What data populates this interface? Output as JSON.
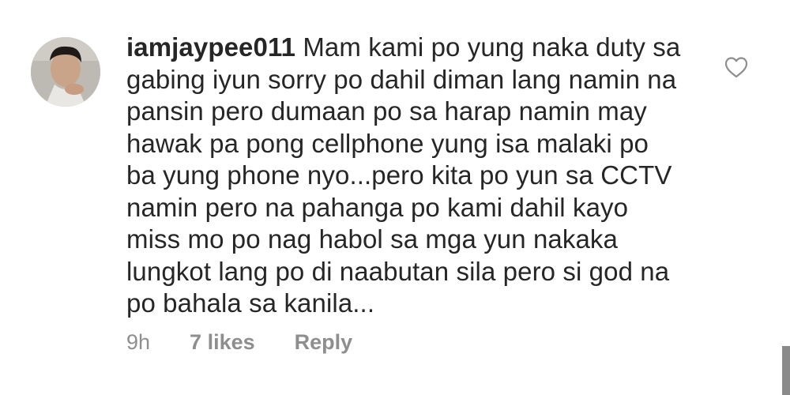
{
  "comment": {
    "username": "iamjaypee011",
    "text_lines": [
      "Mam kami po yung naka duty sa",
      "gabing iyun sorry po dahil diman lang namin na",
      "pansin pero dumaan po sa harap namin may",
      "hawak pa pong cellphone yung isa malaki po",
      "ba yung phone nyo...pero kita po yun sa CCTV",
      "namin pero na pahanga po kami dahil kayo",
      "miss mo po nag habol sa mga yun nakaka",
      "lungkot lang po di naabutan sila pero si god na",
      "po bahala sa kanila..."
    ],
    "time": "9h",
    "likes": "7 likes",
    "reply_label": "Reply",
    "like_icon": "heart-outline-icon"
  }
}
